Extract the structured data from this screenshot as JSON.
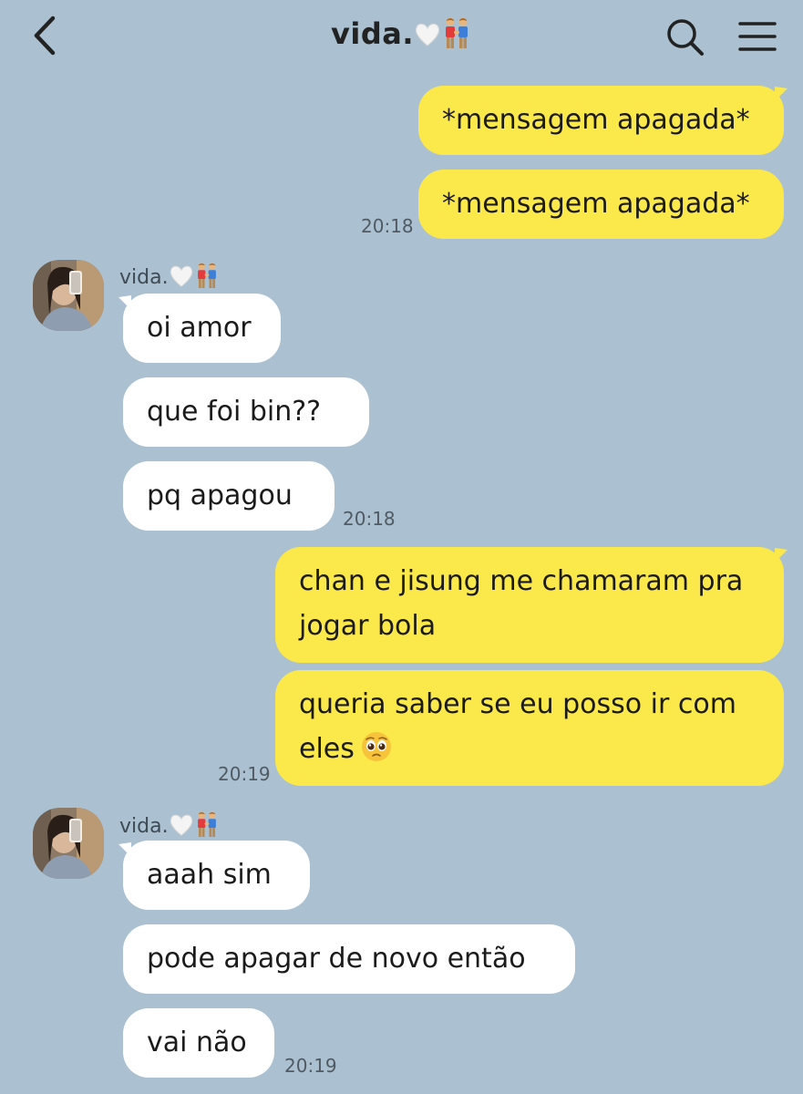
{
  "header": {
    "title": "vida."
  },
  "contact": {
    "name": "vida."
  },
  "messages": {
    "m1": "*mensagem apagada*",
    "m2": "*mensagem apagada*",
    "t1": "20:18",
    "m3": "oi amor",
    "m4": "que foi bin??",
    "m5": "pq apagou",
    "t2": "20:18",
    "m6a": "chan e jisung me chamaram pra",
    "m6b": "jogar bola",
    "m7a": "queria saber se eu posso ir com",
    "m7b": "eles",
    "t3": "20:19",
    "m8": "aaah sim",
    "m9": "pode apagar de novo então",
    "m10": "vai não",
    "t4": "20:19"
  },
  "icons": {
    "back": "chevron-left-icon",
    "search": "search-icon",
    "menu": "hamburger-menu-icon",
    "heart": "white-heart-emoji",
    "couple": "two-men-holding-hands-emoji",
    "pleading": "pleading-face-emoji"
  },
  "colors": {
    "background": "#abc1d1",
    "my_bubble": "#fbe84a",
    "their_bubble": "#ffffff",
    "timestamp": "#515a62"
  }
}
